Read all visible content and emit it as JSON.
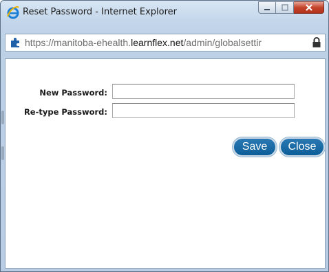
{
  "window": {
    "title": "Reset Password - Internet Explorer"
  },
  "address_bar": {
    "url_prefix": "https://",
    "url_subdomain": "manitoba-ehealth.",
    "url_domain": "learnflex.net",
    "url_path": "/admin/globalsettir"
  },
  "form": {
    "new_password_label": "New Password:",
    "new_password_value": "",
    "retype_password_label": "Re-type Password:",
    "retype_password_value": "",
    "save_label": "Save",
    "close_label": "Close"
  },
  "colors": {
    "button_bg": "#0b5d98",
    "titlebar": "#c3d6ea",
    "close_button": "#c4442b"
  },
  "icons": [
    "ie-icon",
    "minimize-icon",
    "maximize-icon",
    "close-icon",
    "puzzle-icon",
    "lock-icon"
  ]
}
